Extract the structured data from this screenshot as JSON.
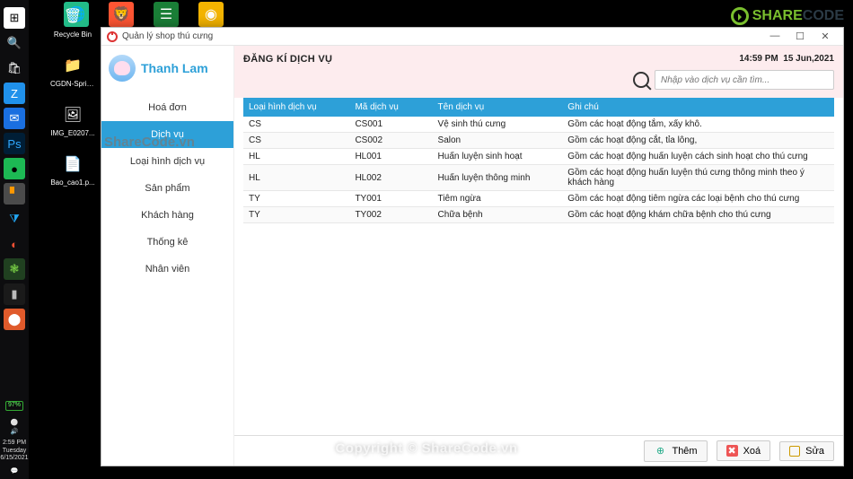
{
  "desktop_icons": [
    {
      "name": "recycle-bin",
      "label": "Recycle Bin",
      "glyph": "🗑",
      "bg": ""
    },
    {
      "name": "cgdn",
      "label": "CGDN-Sprin...",
      "glyph": "📁",
      "bg": ""
    },
    {
      "name": "img",
      "label": "IMG_E0207...",
      "glyph": "🖼",
      "bg": ""
    },
    {
      "name": "baocao",
      "label": "Bao_cao1.p...",
      "glyph": "📄",
      "bg": ""
    }
  ],
  "desktop_top": [
    {
      "name": "edge",
      "glyph": "🌐",
      "bg": "#2b8"
    },
    {
      "name": "brave",
      "glyph": "🦁",
      "bg": "#f53"
    },
    {
      "name": "excel",
      "glyph": "☰",
      "bg": "#1a7f37"
    },
    {
      "name": "chrome",
      "glyph": "◉",
      "bg": "#f4b400"
    }
  ],
  "taskbar": {
    "items": [
      {
        "name": "start",
        "glyph": "⊞",
        "bg": "#fff",
        "color": "#000"
      },
      {
        "name": "search",
        "glyph": "🔍",
        "bg": "",
        "color": "#ddd"
      },
      {
        "name": "store",
        "glyph": "🛍",
        "bg": "",
        "color": "#fff"
      },
      {
        "name": "zalo",
        "glyph": "Z",
        "bg": "#2091eb",
        "color": "#fff"
      },
      {
        "name": "mail",
        "glyph": "✉",
        "bg": "#1a6fe0",
        "color": "#fff"
      },
      {
        "name": "ps",
        "glyph": "Ps",
        "bg": "#001e36",
        "color": "#31a8ff"
      },
      {
        "name": "spotify",
        "glyph": "●",
        "bg": "#1db954",
        "color": "#000"
      },
      {
        "name": "sublime",
        "glyph": "▘",
        "bg": "#4b4b4b",
        "color": "#ff9800"
      },
      {
        "name": "vscode",
        "glyph": "⧩",
        "bg": "",
        "color": "#22a6f2"
      },
      {
        "name": "git",
        "glyph": "◐",
        "bg": "",
        "color": "#f05033"
      },
      {
        "name": "bean",
        "glyph": "❃",
        "bg": "#204020",
        "color": "#7c4"
      },
      {
        "name": "term",
        "glyph": "▮",
        "bg": "#1a1a1a",
        "color": "#bbb"
      },
      {
        "name": "java",
        "glyph": "⬤",
        "bg": "#e05a2b",
        "color": "#fff"
      }
    ],
    "battery": "97%",
    "time": "2:59 PM",
    "day": "Tuesday",
    "date": "6/15/2021"
  },
  "window": {
    "title": "Quản lý shop thú cưng",
    "min": "—",
    "max": "☐",
    "close": "✕"
  },
  "user_name": "Thanh Lam",
  "nav": [
    {
      "key": "hoadon",
      "label": "Hoá đơn",
      "active": false
    },
    {
      "key": "dichvu",
      "label": "Dịch vụ",
      "active": true
    },
    {
      "key": "loaihinh",
      "label": "Loại hình dịch vụ",
      "active": false
    },
    {
      "key": "sanpham",
      "label": "Sản phẩm",
      "active": false
    },
    {
      "key": "khachhang",
      "label": "Khách hàng",
      "active": false
    },
    {
      "key": "thongke",
      "label": "Thống kê",
      "active": false
    },
    {
      "key": "nhanvien",
      "label": "Nhân viên",
      "active": false
    }
  ],
  "header": {
    "title": "ĐĂNG KÍ DỊCH VỤ",
    "time": "14:59 PM",
    "date": "15 Jun,2021"
  },
  "search": {
    "placeholder": "Nhập vào dịch vụ cần tìm..."
  },
  "table": {
    "columns": [
      "Loại hình dịch vụ",
      "Mã dịch vụ",
      "Tên dịch vụ",
      "Ghi chú"
    ],
    "rows": [
      [
        "CS",
        "CS001",
        "Vệ sinh thú cưng",
        "Gồm các hoạt động tắm, xấy khô."
      ],
      [
        "CS",
        "CS002",
        "Salon",
        "Gồm các hoạt động cắt, tỉa lông,"
      ],
      [
        "HL",
        "HL001",
        "Huấn luyện sinh hoạt",
        "Gồm các hoạt động huấn luyện cách sinh hoạt cho thú cưng"
      ],
      [
        "HL",
        "HL002",
        "Huấn luyện thông minh",
        "Gồm các hoạt động huấn luyện thú cưng thông minh theo ý khách hàng"
      ],
      [
        "TY",
        "TY001",
        "Tiêm ngừa",
        "Gồm các hoạt động tiêm ngừa các loại bệnh cho thú cưng"
      ],
      [
        "TY",
        "TY002",
        "Chữa bệnh",
        "Gồm các hoạt động khám chữa bệnh cho thú cưng"
      ]
    ]
  },
  "buttons": {
    "add": "Thêm",
    "delete": "Xoá",
    "edit": "Sửa"
  },
  "watermark": {
    "center": "Copyright © ShareCode.vn",
    "side": "ShareCode.vn",
    "brand_a": "SHARE",
    "brand_b": "CODE",
    ".vn": ".vn"
  }
}
